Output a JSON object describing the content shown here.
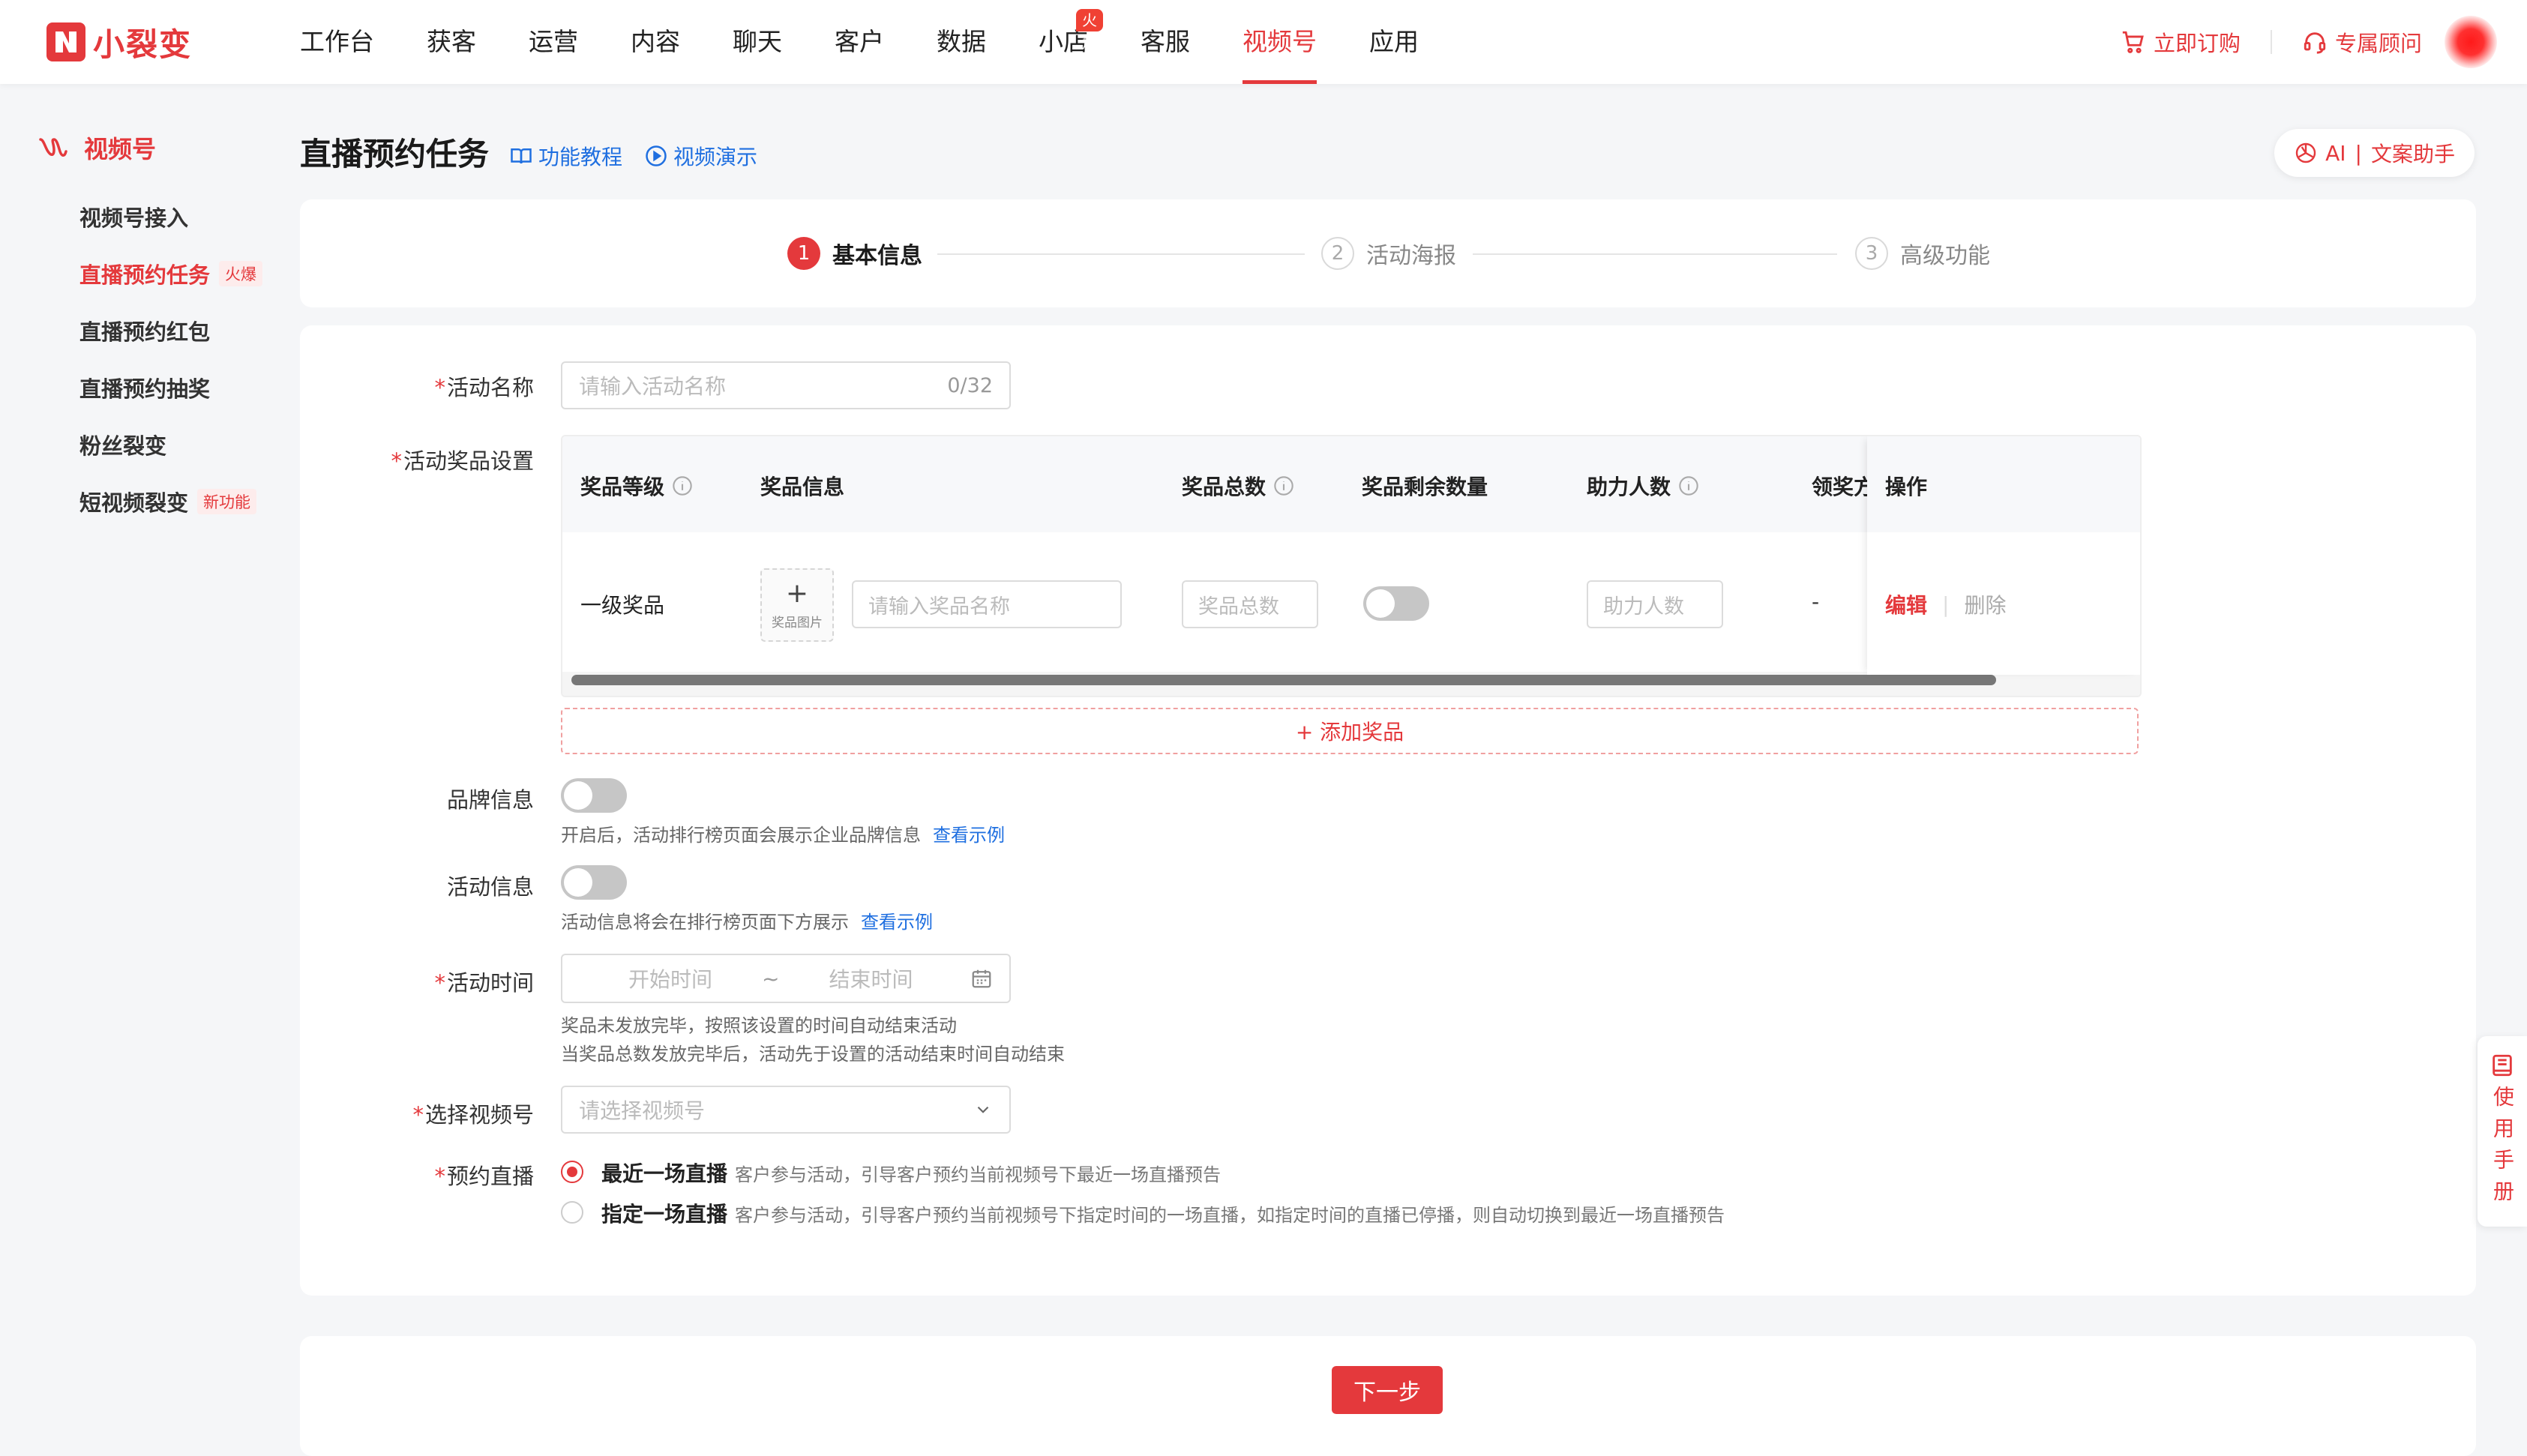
{
  "brand": {
    "name": "小裂变",
    "accent": "#e4393c"
  },
  "nav": {
    "items": [
      {
        "label": "工作台"
      },
      {
        "label": "获客"
      },
      {
        "label": "运营"
      },
      {
        "label": "内容"
      },
      {
        "label": "聊天"
      },
      {
        "label": "客户"
      },
      {
        "label": "数据"
      },
      {
        "label": "小店",
        "badge": "火爆"
      },
      {
        "label": "客服"
      },
      {
        "label": "视频号",
        "active": true
      },
      {
        "label": "应用"
      }
    ],
    "order_label": "立即订购",
    "consultant_label": "专属顾问"
  },
  "sidebar": {
    "title": "视频号",
    "items": [
      {
        "label": "视频号接入"
      },
      {
        "label": "直播预约任务",
        "tag": "火爆",
        "active": true
      },
      {
        "label": "直播预约红包"
      },
      {
        "label": "直播预约抽奖"
      },
      {
        "label": "粉丝裂变"
      },
      {
        "label": "短视频裂变",
        "tag": "新功能"
      }
    ]
  },
  "header": {
    "title": "直播预约任务",
    "tutorial_link": "功能教程",
    "video_link": "视频演示",
    "ai_label": "AI",
    "ai_sep": "|",
    "ai_assistant": "文案助手"
  },
  "steps": [
    {
      "num": "1",
      "label": "基本信息",
      "active": true
    },
    {
      "num": "2",
      "label": "活动海报"
    },
    {
      "num": "3",
      "label": "高级功能"
    }
  ],
  "form": {
    "name": {
      "label": "活动名称",
      "placeholder": "请输入活动名称",
      "counter": "0/32"
    },
    "prize": {
      "label": "活动奖品设置",
      "columns": [
        "奖品等级",
        "奖品信息",
        "奖品总数",
        "奖品剩余数量",
        "助力人数",
        "领奖方",
        "操作"
      ],
      "row": {
        "level": "一级奖品",
        "image_label": "奖品图片",
        "name_placeholder": "请输入奖品名称",
        "total_placeholder": "奖品总数",
        "helpers_placeholder": "助力人数",
        "claim": "-",
        "edit": "编辑",
        "sep": "|",
        "delete": "删除"
      },
      "add_label": "+ 添加奖品"
    },
    "brand": {
      "label": "品牌信息",
      "hint": "开启后，活动排行榜页面会展示企业品牌信息",
      "link": "查看示例",
      "enabled": false
    },
    "activity_info": {
      "label": "活动信息",
      "hint": "活动信息将会在排行榜页面下方展示",
      "link": "查看示例",
      "enabled": false
    },
    "time": {
      "label": "活动时间",
      "start_placeholder": "开始时间",
      "sep": "~",
      "end_placeholder": "结束时间",
      "hint1": "奖品未发放完毕，按照该设置的时间自动结束活动",
      "hint2": "当奖品总数发放完毕后，活动先于设置的活动结束时间自动结束"
    },
    "channel": {
      "label": "选择视频号",
      "placeholder": "请选择视频号"
    },
    "live": {
      "label": "预约直播",
      "options": [
        {
          "title": "最近一场直播",
          "desc": "客户参与活动，引导客户预约当前视频号下最近一场直播预告",
          "selected": true
        },
        {
          "title": "指定一场直播",
          "desc": "客户参与活动，引导客户预约当前视频号下指定时间的一场直播，如指定时间的直播已停播，则自动切换到最近一场直播预告",
          "selected": false
        }
      ]
    }
  },
  "next_label": "下一步",
  "manual_label": "使用手册"
}
